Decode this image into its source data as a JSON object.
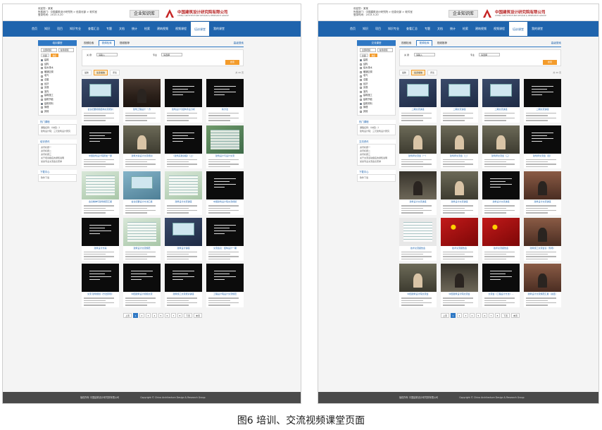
{
  "caption": "图6  培训、交流视频课堂页面",
  "screens": [
    {
      "user_lines": [
        "欢迎您：某某",
        "所属部门：中国建筑设计研究院 > 信息化部 > 软件室",
        "登录时间：2013-5-20"
      ],
      "kb_label": "企业知识库",
      "logo_text": "中国建筑设计研究院有限公司",
      "logo_sub": "CHINA ARCHITECTURE DESIGN & RESEARCH GROUP",
      "nav": [
        "首页",
        "知识",
        "项目",
        "知识专业",
        "查看汇总",
        "专题",
        "文档",
        "统计",
        "检索",
        "建筑视频",
        "视频课程",
        "培训课堂",
        "我的课堂"
      ],
      "active_nav": 11,
      "sidebar": {
        "head": "培训课堂",
        "select": "全部视频",
        "select2": "常用视频",
        "btn1": "全选",
        "btn2": "确定",
        "tree": [
          "建筑",
          "结构",
          "给水排水",
          "暖通空调",
          "电气",
          "总图",
          "经济",
          "景观",
          "室内",
          "建筑施工",
          "建筑节能",
          "建筑材料",
          "管理",
          "其他"
        ],
        "sec1_title": "热门课程",
        "sec1_links": [
          "课程名称：《中国…》",
          "建筑设计院：三元建筑设计研究"
        ],
        "sec2_title": "培训资讯",
        "sec2_links": [
          "资讯标题一",
          "资讯标题二",
          "资讯标题三",
          "关于培训报名的通知说明",
          "某某专业交流会议安排"
        ],
        "sec3_title": "下载中心",
        "sec3_links": [
          "软件下载"
        ]
      },
      "tabs": [
        "视频检索",
        "视频检索",
        "视频推荐"
      ],
      "active_tab": 1,
      "adv_search": "高级搜索",
      "search_labels": [
        "关  键",
        "专业"
      ],
      "search_values": [
        "请输入",
        "请选择"
      ],
      "search_btn": "搜索",
      "sorts": [
        "最新",
        "最多播放",
        "评论"
      ],
      "active_sort": 1,
      "page_count": "共 20 页",
      "cards": [
        {
          "title": "会议纪要视频结构交流培训",
          "kind": "slide"
        },
        {
          "title": "建筑工程设计  一方",
          "kind": "hall"
        },
        {
          "title": "建筑设计与结构专业分析",
          "kind": "dark"
        },
        {
          "title": "新方法",
          "kind": "dark"
        },
        {
          "title": "中国建筑设计院研发一部",
          "kind": "dark"
        },
        {
          "title": "建筑方案设计交流培训",
          "kind": "person"
        },
        {
          "title": "《建筑实践讲座》（上）",
          "kind": "dark"
        },
        {
          "title": "建筑设计与设计交流",
          "kind": "green"
        },
        {
          "title": "会议精神与建筑规范汇报",
          "kind": "chart"
        },
        {
          "title": "会议纪要设计方法汇报",
          "kind": "cyan"
        },
        {
          "title": "建筑设计交流讲座",
          "kind": "chart"
        },
        {
          "title": "中国建筑设计院交流视频",
          "kind": "dark"
        },
        {
          "title": "建筑设计方案",
          "kind": "dark"
        },
        {
          "title": "建筑设计交流规范",
          "kind": "chart"
        },
        {
          "title": "建筑设计讲座",
          "kind": "slide"
        },
        {
          "title": "交流会议：结构设计一期",
          "kind": "dark"
        },
        {
          "title": "交流 建筑规划《方法原则》",
          "kind": "dark"
        },
        {
          "title": "中国建筑设计视频交流",
          "kind": "dark"
        },
        {
          "title": "建筑施工交流培训讲座",
          "kind": "dark"
        },
        {
          "title": "工程设计院设计交流规范",
          "kind": "dark"
        }
      ],
      "pages": [
        "上页",
        "1",
        "2",
        "3",
        "4",
        "5",
        "6",
        "7",
        "8",
        "下页",
        "末页"
      ],
      "active_page": 1,
      "footer": [
        "版权所有 中国建筑设计研究院有限公司",
        "Copyright © China Architecture Design & Research Group"
      ]
    },
    {
      "user_lines": [
        "欢迎您：某某",
        "所属部门：中国建筑设计研究院 > 信息化部 > 软件室",
        "登录时间：2013-5-20"
      ],
      "kb_label": "企业知识库",
      "logo_text": "中国建筑设计研究院有限公司",
      "logo_sub": "CHINA ARCHITECTURE DESIGN & RESEARCH GROUP",
      "nav": [
        "首页",
        "知识",
        "项目",
        "知识专业",
        "查看汇总",
        "专题",
        "文档",
        "统计",
        "检索",
        "建筑视频",
        "视频课程",
        "培训课堂",
        "我的课堂"
      ],
      "active_nav": 11,
      "sidebar": {
        "head": "交流课堂",
        "select": "全部视频",
        "select2": "常用视频",
        "btn1": "全选",
        "btn2": "确定",
        "tree": [
          "建筑",
          "结构",
          "给水排水",
          "暖通空调",
          "电气",
          "总图",
          "经济",
          "景观",
          "室内",
          "建筑施工",
          "建筑节能",
          "建筑材料",
          "管理",
          "其他"
        ],
        "sec1_title": "热门课程",
        "sec1_links": [
          "课程名称：《中国…》",
          "建筑设计院：三元建筑设计研究"
        ],
        "sec2_title": "交流资讯",
        "sec2_links": [
          "资讯标题一",
          "资讯标题二",
          "资讯标题三",
          "关于交流活动报名的通知说明",
          "某某专业交流会议安排"
        ],
        "sec3_title": "下载中心",
        "sec3_links": [
          "软件下载"
        ]
      },
      "tabs": [
        "视频检索",
        "视频检索",
        "视频推荐"
      ],
      "active_tab": 1,
      "adv_search": "高级搜索",
      "search_labels": [
        "关  键",
        "专业"
      ],
      "search_values": [
        "请输入",
        "请选择"
      ],
      "search_btn": "搜索",
      "sorts": [
        "最新",
        "最多播放",
        "评论"
      ],
      "active_sort": 1,
      "page_count": "共 20 页",
      "cards": [
        {
          "title": "二期交流讲座",
          "kind": "slide"
        },
        {
          "title": "二期交流讲座",
          "kind": "slide"
        },
        {
          "title": "二期交流讲座",
          "kind": "slide"
        },
        {
          "title": "二期交流讲座",
          "kind": "dark"
        },
        {
          "title": "建筑师交流会（一）",
          "kind": "person"
        },
        {
          "title": "建筑师交流会（二）",
          "kind": "person"
        },
        {
          "title": "建筑师交流会（三）",
          "kind": "person"
        },
        {
          "title": "建筑师交流会（四）",
          "kind": "dark"
        },
        {
          "title": "建筑设计交流讲座",
          "kind": "mixed"
        },
        {
          "title": "建筑设计交流讲座",
          "kind": "person"
        },
        {
          "title": "建筑设计交流讲座",
          "kind": "dark"
        },
        {
          "title": "建筑设计交流讲座",
          "kind": "brown"
        },
        {
          "title": "技术交流报告会",
          "kind": "white"
        },
        {
          "title": "技术交流报告会",
          "kind": "red"
        },
        {
          "title": "技术交流报告会",
          "kind": "red"
        },
        {
          "title": "建筑施工交流会议（现场）",
          "kind": "brown"
        },
        {
          "title": "中国建筑设计院交流会",
          "kind": "person"
        },
        {
          "title": "中国建筑设计院交流会",
          "kind": "mixed"
        },
        {
          "title": "交流会《工程设计方法》…",
          "kind": "dark"
        },
        {
          "title": "建筑设计交流规范汇报（总结）",
          "kind": "brown"
        }
      ],
      "pages": [
        "上页",
        "1",
        "2",
        "3",
        "4",
        "5",
        "6",
        "7",
        "8",
        "下页",
        "末页"
      ],
      "active_page": 1,
      "footer": [
        "版权所有 中国建筑设计研究院有限公司",
        "Copyright © China Architecture Design & Research Group"
      ]
    }
  ]
}
